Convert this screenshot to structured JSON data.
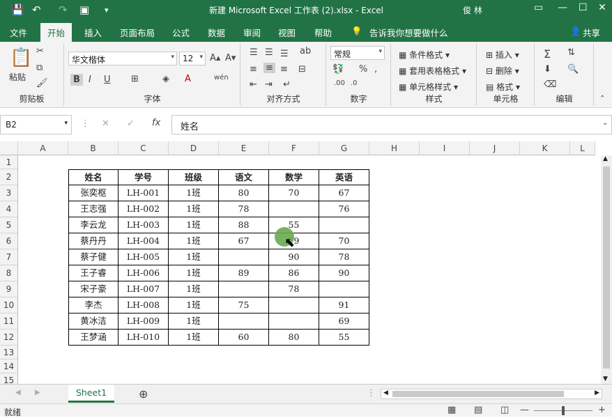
{
  "window": {
    "title": "新建 Microsoft Excel 工作表 (2).xlsx  -  Excel",
    "user": "俊 林"
  },
  "tabs": [
    "文件",
    "开始",
    "插入",
    "页面布局",
    "公式",
    "数据",
    "审阅",
    "视图",
    "帮助"
  ],
  "tell_me": "告诉我你想要做什么",
  "share": "共享",
  "ribbon": {
    "clipboard": {
      "label": "剪贴板",
      "paste": "粘贴"
    },
    "font": {
      "label": "字体",
      "name": "华文楷体",
      "size": "12"
    },
    "alignment": {
      "label": "对齐方式"
    },
    "number": {
      "label": "数字",
      "format": "常规"
    },
    "styles": {
      "label": "样式",
      "items": [
        "条件格式",
        "套用表格格式",
        "单元格样式"
      ]
    },
    "cells": {
      "label": "单元格",
      "items": [
        "插入",
        "删除",
        "格式"
      ]
    },
    "editing": {
      "label": "编辑"
    }
  },
  "formula_bar": {
    "name_box": "B2",
    "content": "姓名"
  },
  "columns": [
    "A",
    "B",
    "C",
    "D",
    "E",
    "F",
    "G",
    "H",
    "I",
    "J",
    "K",
    "L"
  ],
  "rows": [
    "1",
    "2",
    "3",
    "4",
    "5",
    "6",
    "7",
    "8",
    "9",
    "10",
    "11",
    "12",
    "13",
    "14",
    "15"
  ],
  "table": {
    "headers": [
      "姓名",
      "学号",
      "班级",
      "语文",
      "数学",
      "英语"
    ],
    "rows": [
      [
        "张奕枢",
        "LH-001",
        "1班",
        "80",
        "70",
        "67"
      ],
      [
        "王志强",
        "LH-002",
        "1班",
        "78",
        "",
        "76"
      ],
      [
        "李云龙",
        "LH-003",
        "1班",
        "88",
        "55",
        ""
      ],
      [
        "蔡丹丹",
        "LH-004",
        "1班",
        "67",
        "79",
        "70"
      ],
      [
        "蔡子健",
        "LH-005",
        "1班",
        "",
        "90",
        "78"
      ],
      [
        "王子睿",
        "LH-006",
        "1班",
        "89",
        "86",
        "90"
      ],
      [
        "宋子豪",
        "LH-007",
        "1班",
        "",
        "78",
        ""
      ],
      [
        "李杰",
        "LH-008",
        "1班",
        "75",
        "",
        "91"
      ],
      [
        "黄冰洁",
        "LH-009",
        "1班",
        "",
        "",
        "69"
      ],
      [
        "王梦涵",
        "LH-010",
        "1班",
        "60",
        "80",
        "55"
      ]
    ]
  },
  "sheet_tab": "Sheet1",
  "status": "就绪"
}
